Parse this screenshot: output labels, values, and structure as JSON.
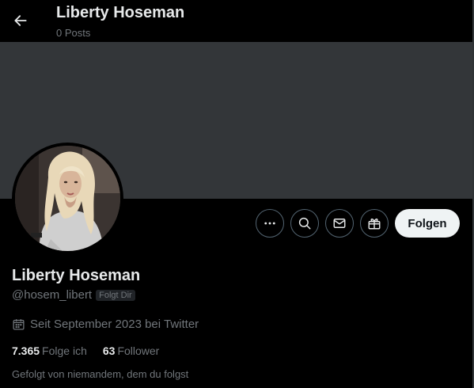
{
  "header": {
    "title": "Liberty Hoseman",
    "subtitle": "0 Posts",
    "back_icon": "arrow-left-icon"
  },
  "profile": {
    "name": "Liberty Hoseman",
    "handle": "@hosem_libert",
    "follows_you_badge": "Folgt Dir",
    "joined": "Seit September 2023 bei Twitter",
    "following_count": "7.365",
    "following_label": "Folge ich",
    "followers_count": "63",
    "followers_label": "Follower",
    "followed_by": "Gefolgt von niemandem, dem du folgst"
  },
  "actions": {
    "more_icon": "more-horizontal-icon",
    "search_icon": "search-icon",
    "message_icon": "envelope-icon",
    "gift_icon": "gift-icon",
    "follow_label": "Folgen"
  },
  "colors": {
    "background": "#000000",
    "banner": "#333639",
    "text_primary": "#e7e9ea",
    "text_secondary": "#71767b",
    "follow_button_bg": "#eff3f4"
  }
}
